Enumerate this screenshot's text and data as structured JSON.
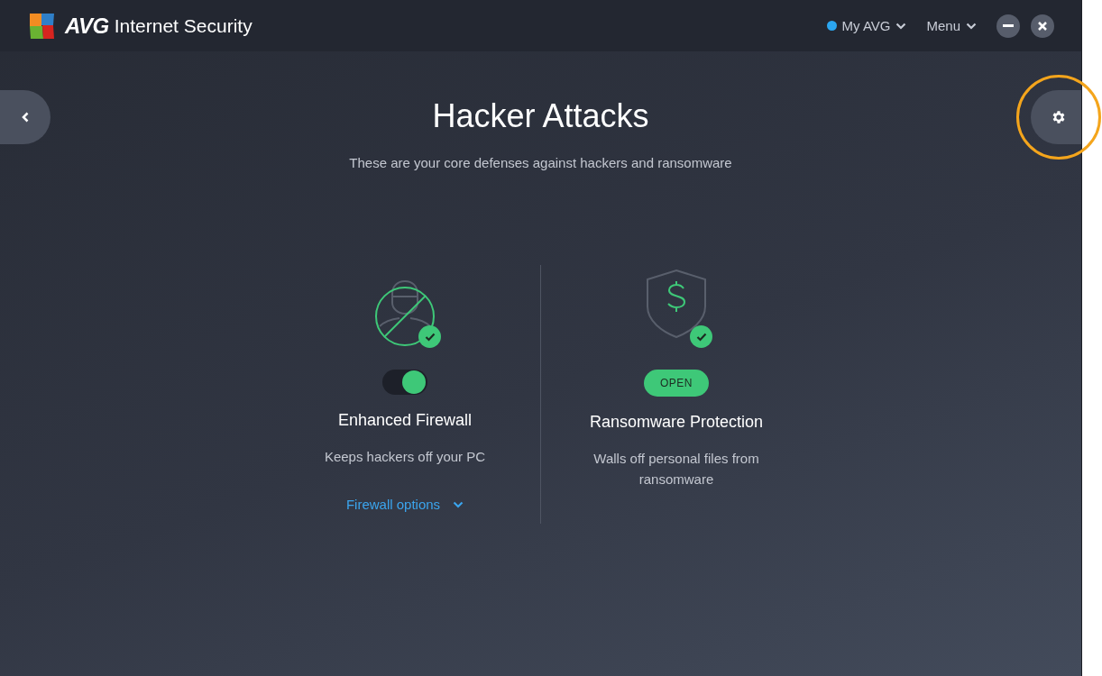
{
  "app": {
    "brand": "AVG",
    "product": "Internet Security"
  },
  "top_bar": {
    "account": {
      "label": "My AVG",
      "connected": true
    },
    "menu": {
      "label": "Menu"
    }
  },
  "page": {
    "title": "Hacker Attacks",
    "subtitle": "These are your core defenses against hackers and ransomware"
  },
  "features": [
    {
      "kind": "toggle",
      "title": "Enhanced Firewall",
      "description": "Keeps hackers off your PC",
      "protected": true,
      "on": true,
      "link": "Firewall options"
    },
    {
      "kind": "button",
      "title": "Ransomware Protection",
      "description": "Walls off personal files from ransomware",
      "protected": true,
      "button": "OPEN"
    }
  ],
  "settings": {
    "highlighted": true
  }
}
